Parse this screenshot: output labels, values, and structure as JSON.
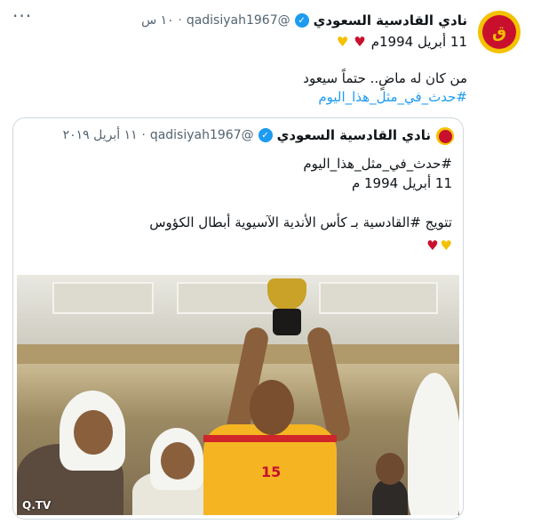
{
  "tweet": {
    "display_name": "نادي القادسية السعودي",
    "handle": "@qadisiyah1967",
    "time": "١٠ س",
    "dot": "·",
    "more": "···",
    "date_line": "11 أبريل 1994م",
    "body": [
      "من كان له ماضٍ.. حتماً سيعود",
      "#حدث_في_مثل_هذا_اليوم"
    ],
    "avatar_text": "ق"
  },
  "quoted": {
    "display_name": "نادي القادسية السعودي",
    "handle": "@qadisiyah1967",
    "time": "١١ أبريل ٢٠١٩",
    "dot": "·",
    "lines": [
      "#حدث_في_مثل_هذا_اليوم",
      "11 أبريل 1994 م",
      "",
      "تتويج  #القادسية بـ كأس الأندية الآسيوية أبطال الكؤوس"
    ],
    "photo": {
      "jersey_number": "15",
      "watermark": "Q.TV"
    }
  },
  "icons": {
    "verified": "verified-badge-icon",
    "heart_red": "red-heart-emoji",
    "heart_yellow": "yellow-heart-emoji"
  },
  "colors": {
    "link": "#1d9bf0",
    "club_red": "#c8102e",
    "club_yellow": "#f3c200"
  }
}
